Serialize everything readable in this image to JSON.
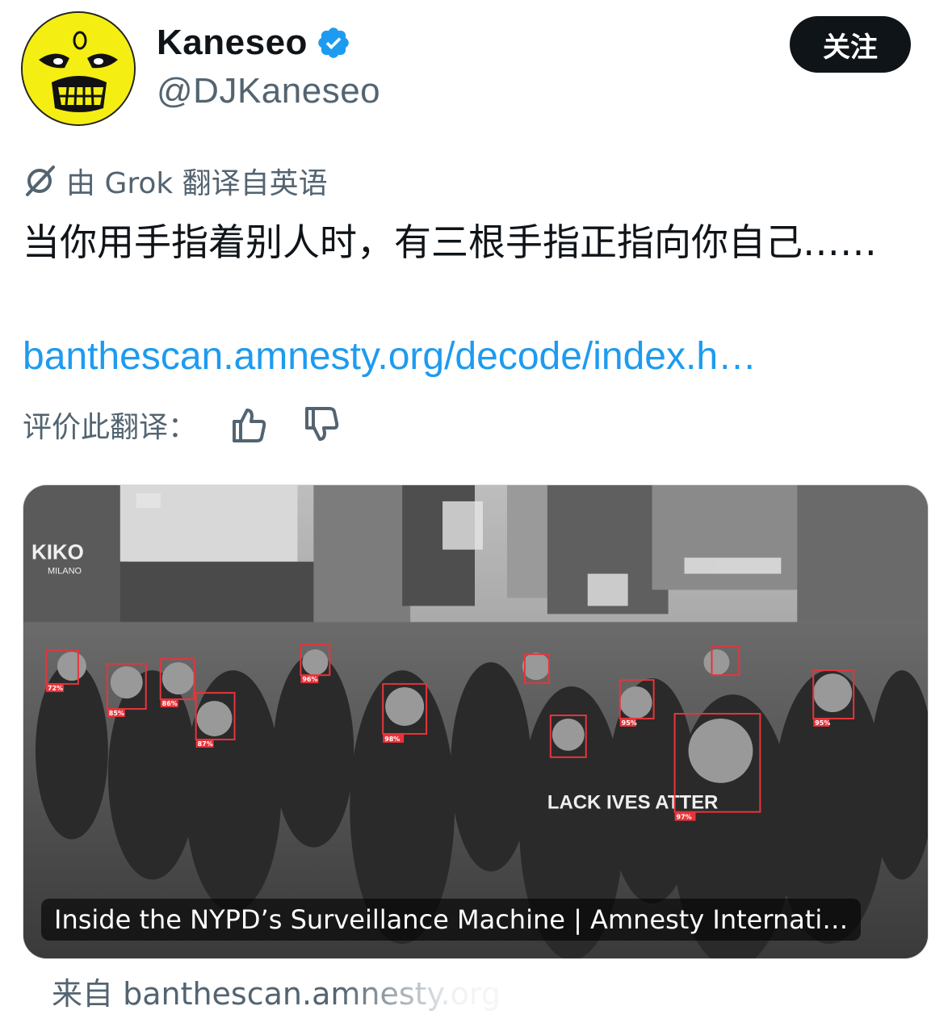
{
  "author": {
    "display_name": "Kaneseo",
    "handle": "@DJKaneseo",
    "avatar_icon": "eddie-skull-avatar",
    "verified_icon": "verified-badge-icon",
    "verified_color": "#1d9bf0"
  },
  "follow_button": {
    "label": "关注"
  },
  "translation": {
    "icon": "grok-icon",
    "label": "由 Grok 翻译自英语"
  },
  "tweet": {
    "text": "当你用手指着别人时，有三根手指正指向你自己……",
    "link": "banthescan.amnesty.org/decode/index.h…"
  },
  "rating": {
    "label": "评价此翻译：",
    "like_icon": "thumbs-up-icon",
    "dislike_icon": "thumbs-down-icon"
  },
  "card": {
    "image_signs": {
      "store": "KIKO",
      "store_sub": "MILANO",
      "shirt_text": "LACK IVES ATTER"
    },
    "face_boxes": [
      "72%",
      "85%",
      "86%",
      "87%",
      "98%",
      "96%",
      "97%",
      "95%",
      "95%"
    ],
    "title": "Inside the NYPD’s Surveillance Machine | Amnesty Internati…",
    "source": "来自 banthescan.amnesty.org"
  },
  "colors": {
    "link": "#1d9bf0",
    "secondary_text": "#536471",
    "primary_text": "#0f1419",
    "face_box": "#e8343a"
  }
}
